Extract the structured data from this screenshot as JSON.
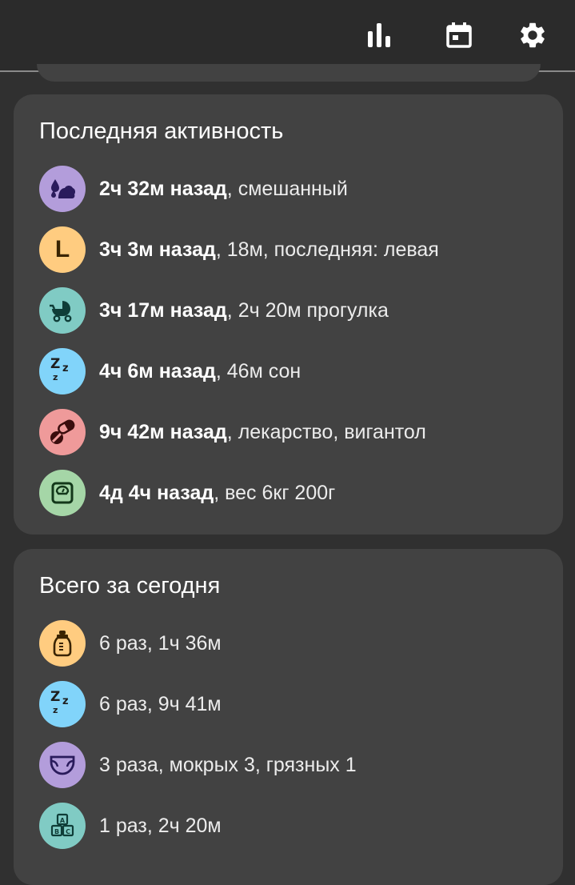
{
  "appbar": {
    "icons": [
      "bar-chart-icon",
      "calendar-icon",
      "gear-icon"
    ]
  },
  "recent": {
    "title": "Последняя активность",
    "items": [
      {
        "icon": "diaper-drops-icon",
        "color": "#b39ddb",
        "bold": "2ч 32м назад",
        "rest": ", смешанный"
      },
      {
        "icon": "letter-l-icon",
        "color": "#ffcc80",
        "letter": "L",
        "bold": "3ч 3м назад",
        "rest": ", 18м, последняя: левая"
      },
      {
        "icon": "stroller-icon",
        "color": "#80cbc4",
        "bold": "3ч 17м назад",
        "rest": ", 2ч 20м прогулка"
      },
      {
        "icon": "sleep-zz-icon",
        "color": "#81d4fa",
        "bold": "4ч 6м назад",
        "rest": ", 46м сон"
      },
      {
        "icon": "pills-icon",
        "color": "#ef9a9a",
        "bold": "9ч 42м назад",
        "rest": ", лекарство, вигантол"
      },
      {
        "icon": "scale-icon",
        "color": "#a5d6a7",
        "bold": "4д 4ч назад",
        "rest": ", вес 6кг 200г"
      }
    ]
  },
  "today": {
    "title": "Всего за сегодня",
    "items": [
      {
        "icon": "bottle-icon",
        "color": "#ffcc80",
        "text": "6 раз, 1ч 36м"
      },
      {
        "icon": "sleep-zz-icon",
        "color": "#81d4fa",
        "text": "6 раз, 9ч 41м"
      },
      {
        "icon": "diaper-icon",
        "color": "#b39ddb",
        "text": "3 раза, мокрых 3, грязных 1"
      },
      {
        "icon": "abc-blocks-icon",
        "color": "#80cbc4",
        "text": "1 раз, 2ч 20м"
      }
    ]
  }
}
